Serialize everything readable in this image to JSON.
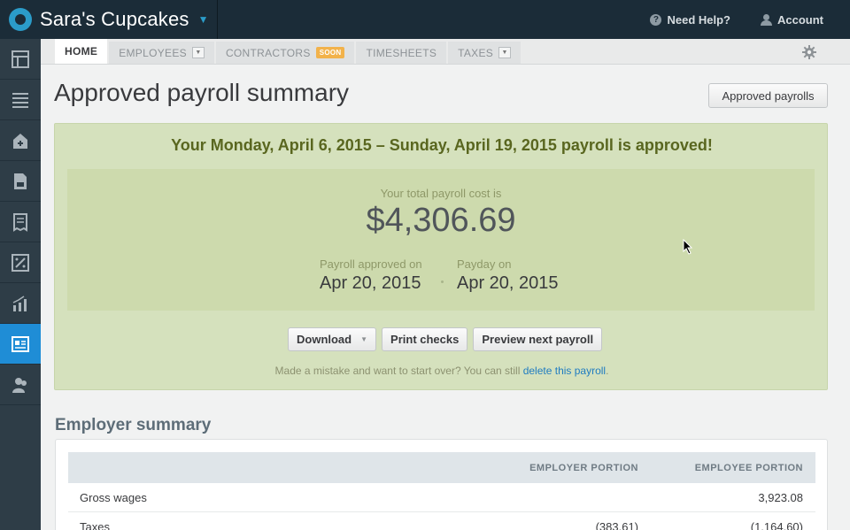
{
  "app": {
    "company": "Sara's Cupcakes"
  },
  "topbar": {
    "help": "Need Help?",
    "account": "Account"
  },
  "rail": [
    "dashboard-icon",
    "list-icon",
    "home-add-icon",
    "document-icon",
    "receipt-icon",
    "percent-icon",
    "chart-icon",
    "payroll-icon",
    "employees-icon"
  ],
  "tabs": {
    "home": "HOME",
    "employees": "EMPLOYEES",
    "contractors": "CONTRACTORS",
    "soon": "SOON",
    "timesheets": "TIMESHEETS",
    "taxes": "TAXES"
  },
  "page": {
    "title": "Approved payroll summary",
    "approved_button": "Approved payrolls"
  },
  "panel": {
    "headline": "Your Monday, April 6, 2015 – Sunday, April 19, 2015 payroll is approved!",
    "cost_label": "Your total payroll cost is",
    "cost": "$4,306.69",
    "approved_label": "Payroll approved on",
    "approved_date": "Apr 20, 2015",
    "payday_label": "Payday on",
    "payday_date": "Apr 20, 2015",
    "download": "Download",
    "print": "Print checks",
    "preview": "Preview next payroll",
    "mistake_text": "Made a mistake and want to start over? You can still ",
    "mistake_link": "delete this payroll",
    "mistake_end": "."
  },
  "summary": {
    "title": "Employer summary",
    "columns": [
      "",
      "EMPLOYER PORTION",
      "EMPLOYEE PORTION"
    ],
    "rows": [
      {
        "label": "Gross wages",
        "employer": "",
        "employee": "3,923.08"
      },
      {
        "label": "Taxes",
        "employer": "(383.61)",
        "employee": "(1,164.60)"
      }
    ]
  },
  "colors": {
    "topbar": "#1b2c38",
    "rail": "#2e3d47",
    "active": "#1f8dd6",
    "panel": "#d5e1bd",
    "headline": "#59661f",
    "link": "#1f7cc1"
  }
}
